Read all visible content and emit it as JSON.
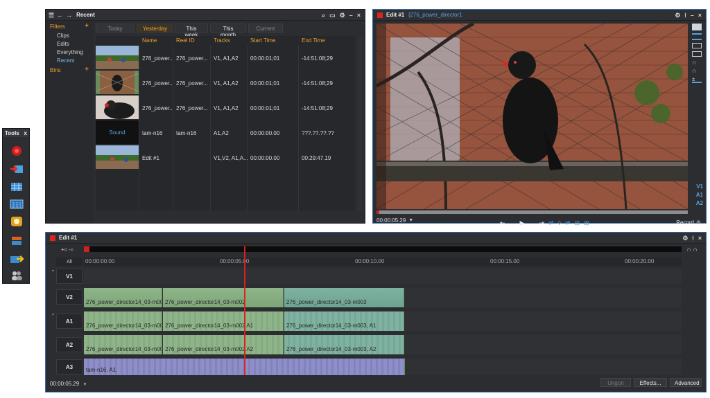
{
  "tools": {
    "title": "Tools",
    "close": "x"
  },
  "recent": {
    "title": "Recent",
    "filters_label": "Filters",
    "filters": [
      "Clips",
      "Edits",
      "Everything",
      "Recent"
    ],
    "bins_label": "Bins",
    "tabs": [
      "Today",
      "Yesterday",
      "This week",
      "This month",
      "Current"
    ],
    "columns": [
      "Name",
      "Reel ID",
      "Tracks",
      "Start Time",
      "End Time"
    ],
    "rows": [
      {
        "name": "276_power..",
        "reel": "276_power...",
        "tracks": "V1, A1,A2",
        "start": "00:00:01;01",
        "end": "-14:51:08;29"
      },
      {
        "name": "276_power..",
        "reel": "276_power...",
        "tracks": "V1, A1,A2",
        "start": "00:00:01;01",
        "end": "-14:51:08;29"
      },
      {
        "name": "276_power..",
        "reel": "276_power...",
        "tracks": "V1, A1,A2",
        "start": "00:00:01;01",
        "end": "-14:51:08;29"
      },
      {
        "name": "tam-n16",
        "reel": "tam-n16",
        "tracks": "A1,A2",
        "start": "00:00:00.00",
        "end": "???.??.??.??"
      },
      {
        "name": "Edit #1",
        "reel": "",
        "tracks": "V1,V2, A1,A...",
        "start": "00:00:00.00",
        "end": "00:29:47.19"
      }
    ],
    "sound_label": "Sound"
  },
  "viewer": {
    "title": "Edit #1",
    "subtitle": "[276_power_director1",
    "timecode": "00:00:05.29",
    "track_labels": [
      "V1",
      "A1",
      "A2"
    ],
    "record_label": "Record"
  },
  "timeline": {
    "title": "Edit #1",
    "all_label": "All",
    "ruler": [
      "00:00:00.00",
      "00:00:05.00",
      "00:00:10.00",
      "00:00:15.00",
      "00:00:20.00"
    ],
    "tracks": [
      "V1",
      "V2",
      "A1",
      "A2",
      "A3"
    ],
    "clips_v2": [
      "276_power_director14_03-m00",
      "276_power_director14_03-m002",
      "276_power_director14_03-m003"
    ],
    "clips_a1": [
      "276_power_director14_03-m00",
      "276_power_director14_03-m002 A1",
      "276_power_director14_03-m003, A1"
    ],
    "clips_a2": [
      "276_power_director14_03-m00",
      "276_power_director14_03-m002 A2",
      "276_power_director14_03-m003, A2"
    ],
    "clip_a3": "tam-n16, A1",
    "timecode": "00:00:05.29",
    "buttons": {
      "ungon": "Ungon",
      "effects": "Effects...",
      "advanced": "Advanced"
    }
  }
}
